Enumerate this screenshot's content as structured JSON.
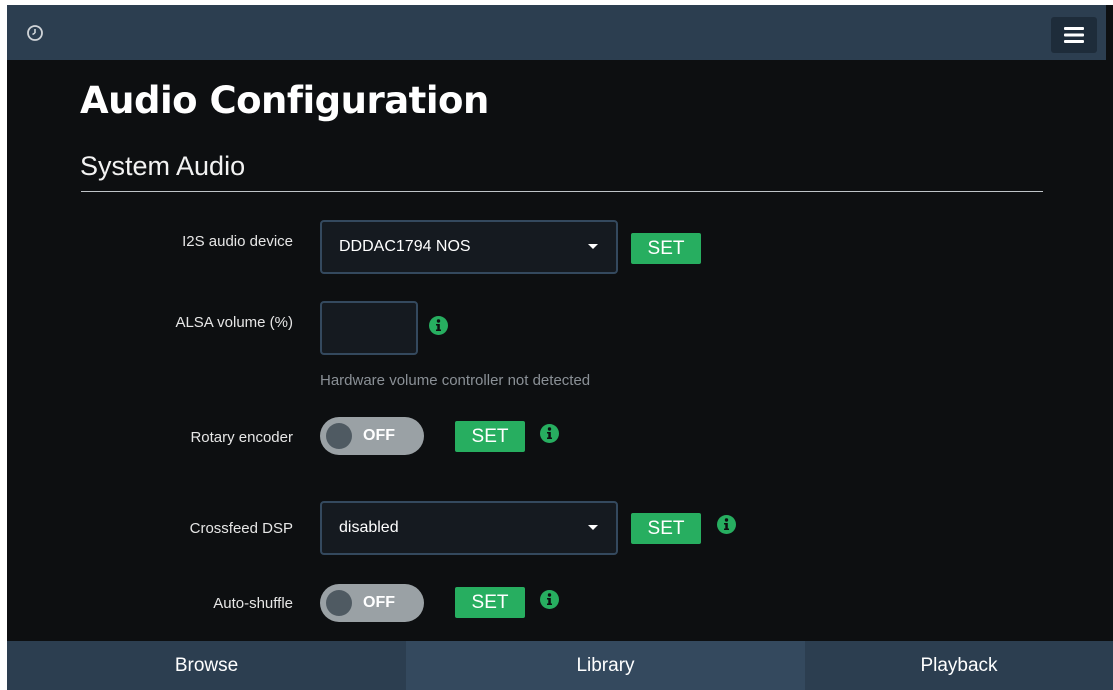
{
  "header": {
    "clock_icon": "clock-icon",
    "menu_icon": "hamburger-menu-icon"
  },
  "page": {
    "title": "Audio Configuration",
    "section_title": "System Audio"
  },
  "settings": {
    "i2s": {
      "label": "I2S audio device",
      "selected": "DDDAC1794 NOS",
      "set_label": "SET"
    },
    "alsa_volume": {
      "label": "ALSA volume (%)",
      "value": "",
      "help": "Hardware volume controller not detected"
    },
    "rotary": {
      "label": "Rotary encoder",
      "toggle": "OFF",
      "set_label": "SET"
    },
    "crossfeed": {
      "label": "Crossfeed DSP",
      "selected": "disabled",
      "set_label": "SET"
    },
    "auto_shuffle": {
      "label": "Auto-shuffle",
      "toggle": "OFF",
      "set_label": "SET"
    }
  },
  "nav": {
    "browse": "Browse",
    "library": "Library",
    "playback": "Playback"
  },
  "colors": {
    "background": "#0d0f11",
    "header": "#2c3e50",
    "accent_green": "#27ae60",
    "nav_dark": "#2c3e50",
    "nav_active": "#34495e"
  }
}
